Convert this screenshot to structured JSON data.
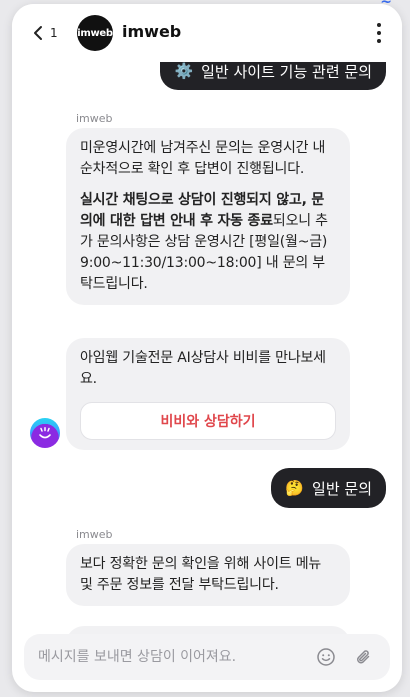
{
  "header": {
    "back_count": "1",
    "brand_logo_text": "imweb",
    "brand_name": "imweb"
  },
  "messages": {
    "user_top": {
      "icon": "gear-icon",
      "emoji": "⚙️",
      "text": "일반 사이트 기능 관련 문의"
    },
    "bot_group_1": {
      "sender": "imweb",
      "msg1_p1": "미운영시간에 남겨주신 문의는 운영시간 내 순차적으로 확인 후 답변이 진행됩니다.",
      "msg1_p2_bold": "실시간 채팅으로 상담이 진행되지 않고, 문의에 대한 답변 안내 후 자동 종료",
      "msg1_p2_rest": "되오니 추가 문의사항은 상담 운영시간 [평일(월~금) 9:00~11:30/13:00~18:00] 내 문의 부탁드립니다.",
      "msg2_text": "아임웹 기술전문 AI상담사 비비를 만나보세요.",
      "consult_button": "비비와 상담하기"
    },
    "user_mid": {
      "icon": "thinking-face-icon",
      "emoji": "🤔",
      "text": "일반 문의"
    },
    "bot_group_2": {
      "sender": "imweb",
      "msg1_text": "보다 정확한 문의 확인을 위해 사이트 메뉴 및 주문 정보를 전달 부탁드립니다."
    }
  },
  "input": {
    "placeholder": "메시지를 보내면 상담이 이어져요.",
    "emoji_icon": "smile-icon",
    "attach_icon": "paperclip-icon"
  },
  "colors": {
    "user_bubble": "#222226",
    "bot_bubble": "#f1f1f3",
    "consult_button_text": "#e0474c"
  }
}
